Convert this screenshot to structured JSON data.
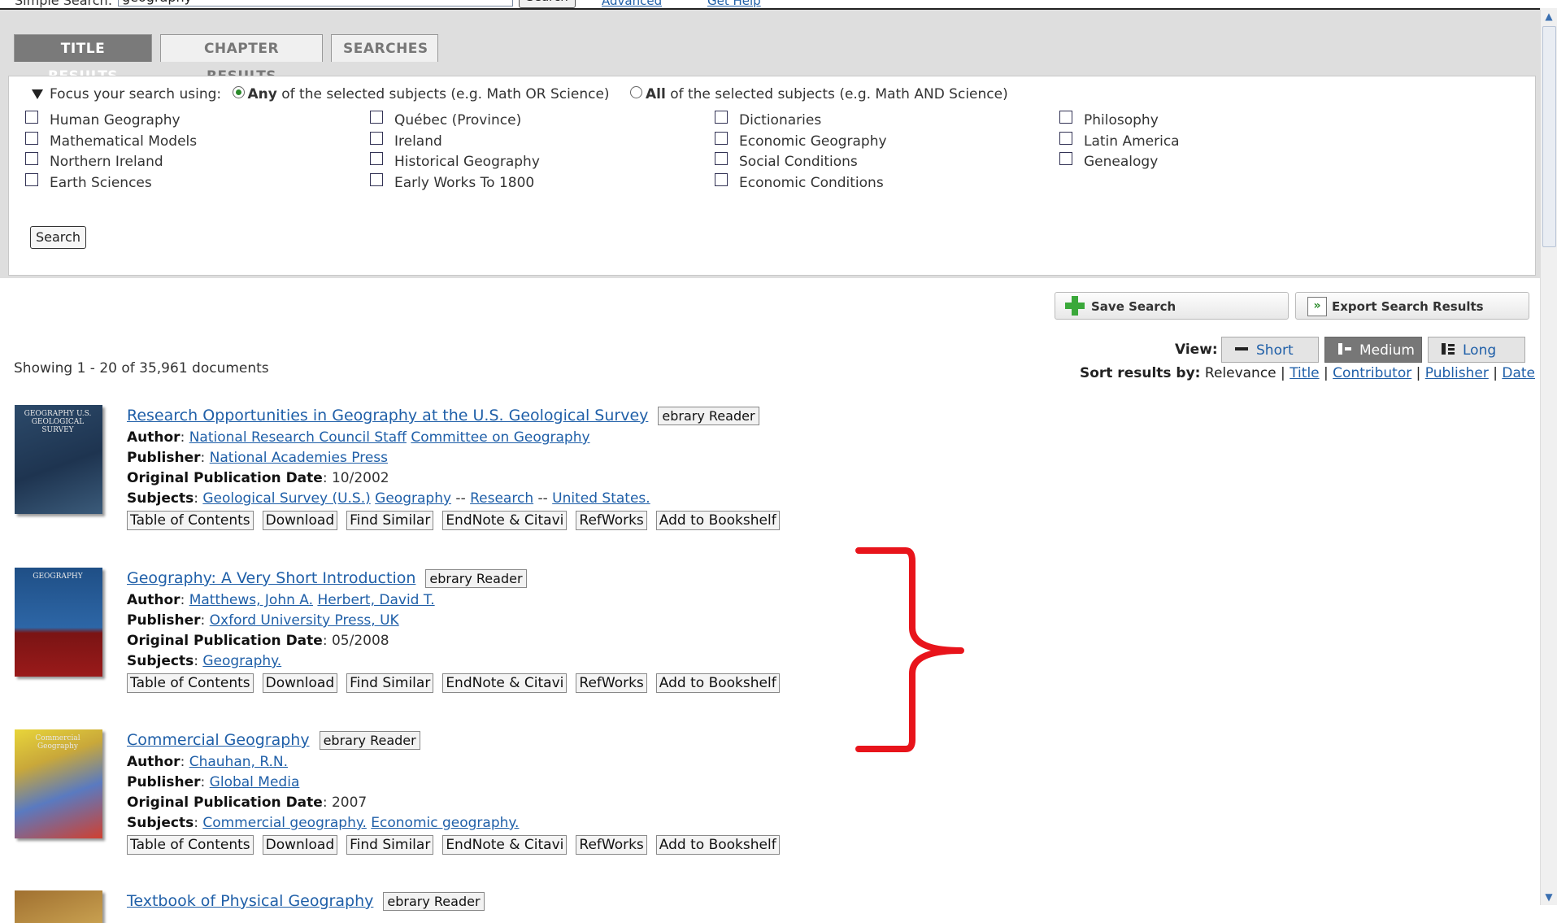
{
  "top_search": {
    "label": "Simple Search:",
    "value": "geography",
    "button": "Search",
    "link1": "Advanced",
    "link2": "Get Help"
  },
  "tabs": [
    "TITLE RESULTS",
    "CHAPTER RESULTS",
    "SEARCHES"
  ],
  "focus": {
    "prefix": "Focus your search using:",
    "any_bold": "Any",
    "any_rest": "of the selected subjects (e.g. Math OR Science)",
    "all_bold": "All",
    "all_rest": "of the selected subjects (e.g. Math AND Science)",
    "subjects": [
      [
        "Human Geography",
        "Mathematical Models",
        "Northern Ireland",
        "Earth Sciences"
      ],
      [
        "Québec (Province)",
        "Ireland",
        "Historical Geography",
        "Early Works To 1800"
      ],
      [
        "Dictionaries",
        "Economic Geography",
        "Social Conditions",
        "Economic Conditions"
      ],
      [
        "Philosophy",
        "Latin America",
        "Genealogy"
      ]
    ],
    "search_button": "Search"
  },
  "actions": {
    "save": "Save Search",
    "export": "Export Search Results"
  },
  "view": {
    "label": "View:",
    "options": [
      "Short",
      "Medium",
      "Long"
    ],
    "selected": "Medium"
  },
  "sort": {
    "label": "Sort results by:",
    "current": "Relevance",
    "links": [
      "Title",
      "Contributor",
      "Publisher",
      "Date"
    ]
  },
  "showing": "Showing 1 - 20 of 35,961 documents",
  "field_labels": {
    "author": "Author",
    "publisher": "Publisher",
    "date": "Original Publication Date",
    "subjects": "Subjects"
  },
  "reader_label": "ebrary Reader",
  "result_buttons": [
    "Table of Contents",
    "Download",
    "Find Similar",
    "EndNote & Citavi",
    "RefWorks",
    "Add to Bookshelf"
  ],
  "results": [
    {
      "title": "Research Opportunities in Geography at the U.S. Geological Survey",
      "authors": [
        "National Research Council Staff",
        "Committee on Geography"
      ],
      "publisher": "National Academies Press",
      "date": "10/2002",
      "subjects": [
        "Geological Survey (U.S.)",
        "Geography",
        "Research",
        "United States."
      ],
      "cover_text": "GEOGRAPHY U.S. GEOLOGICAL SURVEY"
    },
    {
      "title": "Geography: A Very Short Introduction",
      "authors": [
        "Matthews, John A.",
        "Herbert, David T."
      ],
      "publisher": "Oxford University Press, UK",
      "date": "05/2008",
      "subjects": [
        "Geography."
      ],
      "cover_text": "GEOGRAPHY"
    },
    {
      "title": "Commercial Geography",
      "authors": [
        "Chauhan, R.N."
      ],
      "publisher": "Global Media",
      "date": "2007",
      "subjects": [
        "Commercial geography.",
        "Economic geography."
      ],
      "cover_text": "Commercial Geography"
    },
    {
      "title": "Textbook of Physical Geography"
    }
  ],
  "annotation_color": "#e8141b"
}
